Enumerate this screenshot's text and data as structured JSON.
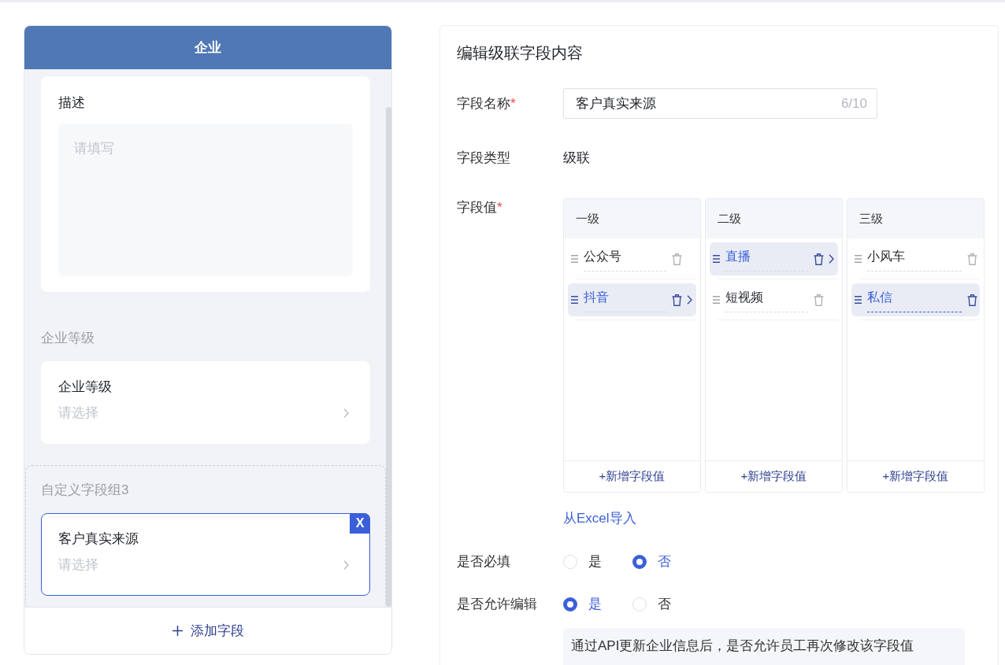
{
  "form_preview": {
    "title": "企业",
    "groups": [
      {
        "active": false,
        "fields": [
          {
            "kind": "textarea",
            "label": "描述",
            "placeholder": "请填写",
            "selected": false
          }
        ]
      },
      {
        "title": "企业等级",
        "active": false,
        "fields": [
          {
            "kind": "select",
            "label": "企业等级",
            "placeholder": "请选择",
            "selected": false
          }
        ]
      },
      {
        "title": "自定义字段组3",
        "active": true,
        "fields": [
          {
            "kind": "select",
            "label": "客户真实来源",
            "placeholder": "请选择",
            "selected": true,
            "remove_label": "X"
          }
        ]
      }
    ],
    "add_field": "添加字段"
  },
  "editor": {
    "title": "编辑级联字段内容",
    "name_field": {
      "label": "字段名称",
      "required_mark": "*",
      "value": "客户真实来源",
      "counter": "6/10"
    },
    "type_field": {
      "label": "字段类型",
      "value": "级联"
    },
    "values_field": {
      "label": "字段值",
      "required_mark": "*",
      "columns": [
        {
          "title": "一级",
          "items": [
            {
              "text": "公众号",
              "selected": false,
              "editing": false
            },
            {
              "text": "抖音",
              "selected": true,
              "editing": false
            }
          ],
          "add_label": "+新增字段值"
        },
        {
          "title": "二级",
          "items": [
            {
              "text": "直播",
              "selected": true,
              "editing": false
            },
            {
              "text": "短视频",
              "selected": false,
              "editing": false
            }
          ],
          "add_label": "+新增字段值"
        },
        {
          "title": "三级",
          "items": [
            {
              "text": "小风车",
              "selected": false,
              "editing": false
            },
            {
              "text": "私信",
              "selected": true,
              "editing": true
            }
          ],
          "add_label": "+新增字段值"
        }
      ],
      "import_link": "从Excel导入"
    },
    "required_setting": {
      "label": "是否必填",
      "options": [
        {
          "label": "是",
          "selected": false
        },
        {
          "label": "否",
          "selected": true
        }
      ]
    },
    "editable_setting": {
      "label": "是否允许编辑",
      "options": [
        {
          "label": "是",
          "selected": true
        },
        {
          "label": "否",
          "selected": false
        }
      ],
      "hint": "通过API更新企业信息后，是否允许员工再次修改该字段值"
    }
  }
}
